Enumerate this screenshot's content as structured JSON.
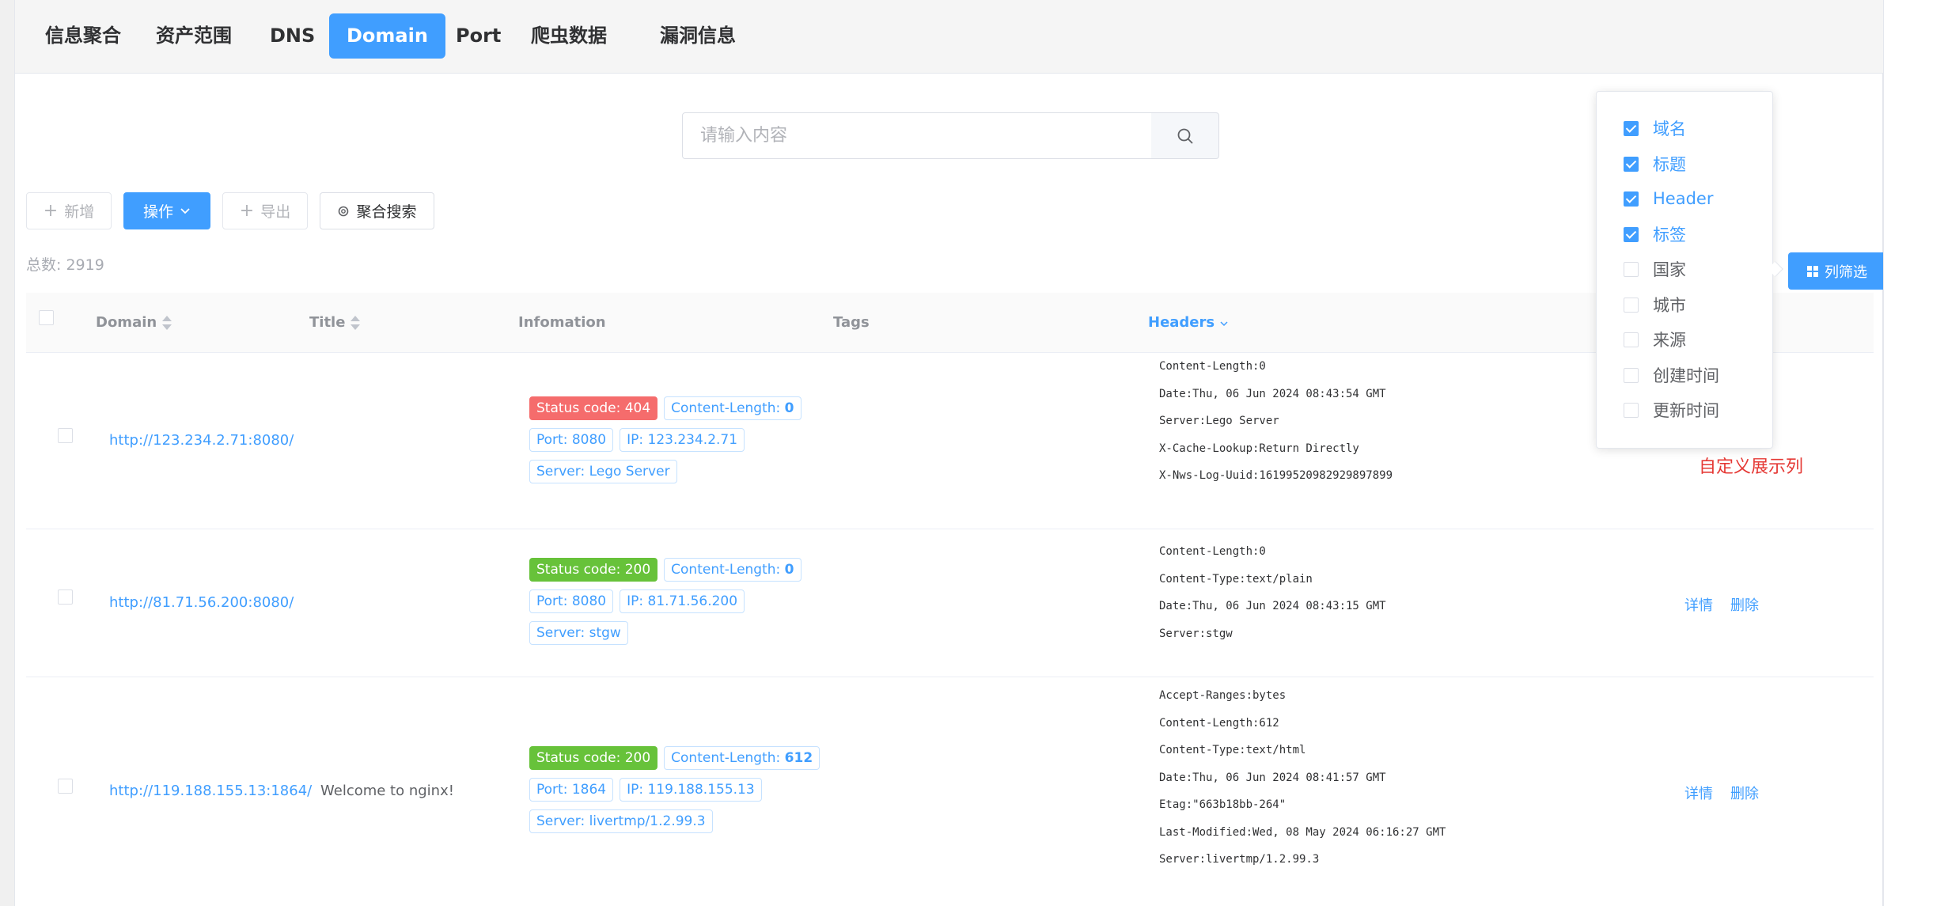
{
  "tabs": [
    "信息聚合",
    "资产范围",
    "DNS",
    "Domain",
    "Port",
    "爬虫数据",
    "漏洞信息"
  ],
  "active_tab": "Domain",
  "search": {
    "placeholder": "请输入内容"
  },
  "toolbar": {
    "add_label": "新增",
    "ops_label": "操作",
    "export_label": "导出",
    "agg_search_label": "聚合搜索"
  },
  "total_label": "总数: 2919",
  "columns": {
    "domain": "Domain",
    "title": "Title",
    "info": "Infomation",
    "tags": "Tags",
    "headers": "Headers"
  },
  "column_filter": {
    "button_label": "列筛选",
    "options": [
      {
        "label": "域名",
        "checked": true
      },
      {
        "label": "标题",
        "checked": true
      },
      {
        "label": "Header",
        "checked": true
      },
      {
        "label": "标签",
        "checked": true
      },
      {
        "label": "国家",
        "checked": false
      },
      {
        "label": "城市",
        "checked": false
      },
      {
        "label": "来源",
        "checked": false
      },
      {
        "label": "创建时间",
        "checked": false
      },
      {
        "label": "更新时间",
        "checked": false
      }
    ]
  },
  "annotation": "自定义展示列",
  "rows": [
    {
      "domain": "http://123.234.2.71:8080/",
      "title": "",
      "status_label": "Status code: 404",
      "status_type": "danger",
      "content_length_label": "Content-Length:",
      "content_length_value": "0",
      "port_label": "Port: 8080",
      "ip_label": "IP: 123.234.2.71",
      "server_label": "Server: Lego Server",
      "headers": [
        "Content-Length:0",
        "Date:Thu, 06 Jun 2024 08:43:54 GMT",
        "Server:Lego Server",
        "X-Cache-Lookup:Return Directly",
        "X-Nws-Log-Uuid:16199520982929897899"
      ],
      "ops": []
    },
    {
      "domain": "http://81.71.56.200:8080/",
      "title": "",
      "status_label": "Status code: 200",
      "status_type": "success",
      "content_length_label": "Content-Length:",
      "content_length_value": "0",
      "port_label": "Port: 8080",
      "ip_label": "IP: 81.71.56.200",
      "server_label": "Server: stgw",
      "headers": [
        "Content-Length:0",
        "Content-Type:text/plain",
        "Date:Thu, 06 Jun 2024 08:43:15 GMT",
        "Server:stgw"
      ],
      "ops": [
        "详情",
        "删除"
      ]
    },
    {
      "domain": "http://119.188.155.13:1864/",
      "title": "Welcome to nginx!",
      "status_label": "Status code: 200",
      "status_type": "success",
      "content_length_label": "Content-Length:",
      "content_length_value": "612",
      "port_label": "Port: 1864",
      "ip_label": "IP: 119.188.155.13",
      "server_label": "Server: livertmp/1.2.99.3",
      "headers": [
        "Accept-Ranges:bytes",
        "Content-Length:612",
        "Content-Type:text/html",
        "Date:Thu, 06 Jun 2024 08:41:57 GMT",
        "Etag:\"663b18bb-264\"",
        "Last-Modified:Wed, 08 May 2024 06:16:27 GMT",
        "Server:livertmp/1.2.99.3"
      ],
      "ops": [
        "详情",
        "删除"
      ]
    }
  ],
  "colors": {
    "primary": "#409eff",
    "danger": "#f56c6c",
    "success": "#67c23a",
    "annotation": "#e53935"
  }
}
